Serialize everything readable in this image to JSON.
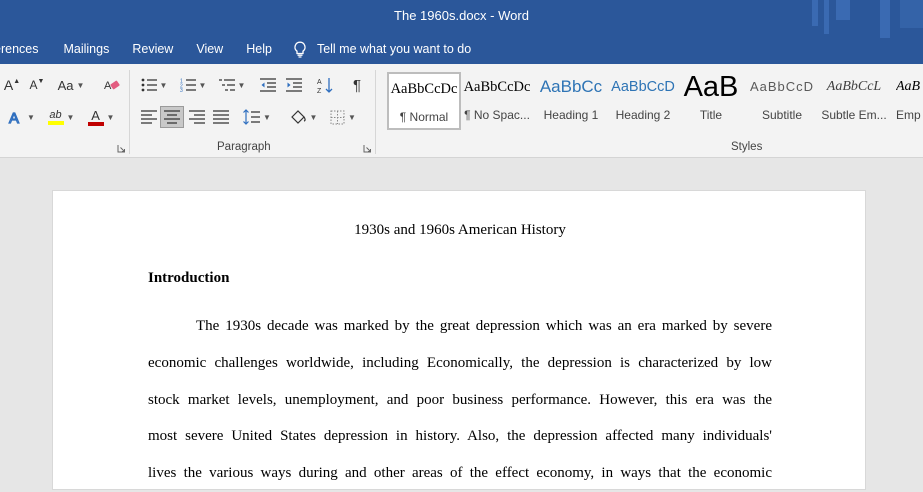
{
  "window": {
    "title": "The 1960s.docx  -  Word"
  },
  "ribbon_tabs": [
    "erences",
    "Mailings",
    "Review",
    "View",
    "Help"
  ],
  "tell_me": {
    "label": "Tell me what you want to do",
    "icon": "lightbulb-icon"
  },
  "font_group": {
    "grow_label": "A",
    "shrink_label": "A",
    "case_label": "Aa",
    "highlight_label": "ab",
    "font_color_label": "A",
    "highlight_color": "#ffff00",
    "font_color": "#c00000"
  },
  "paragraph_group": {
    "label": "Paragraph",
    "show_marks": "¶",
    "selected_alignment": "center"
  },
  "styles_group": {
    "label": "Styles",
    "items": [
      {
        "sample": "AaBbCcDc",
        "name": "¶ Normal",
        "selected": true
      },
      {
        "sample": "AaBbCcDc",
        "name": "¶ No Spac..."
      },
      {
        "sample": "AaBbCc",
        "name": "Heading 1"
      },
      {
        "sample": "AaBbCcD",
        "name": "Heading 2"
      },
      {
        "sample": "AaB",
        "name": "Title"
      },
      {
        "sample": "AaBbCcD",
        "name": "Subtitle"
      },
      {
        "sample": "AaBbCcL",
        "name": "Subtle Em..."
      },
      {
        "sample": "AaB",
        "name": "Emp"
      }
    ]
  },
  "document": {
    "title": "1930s and 1960s American History",
    "heading": "Introduction",
    "paragraph_lines": [
      "The 1930s decade was marked by the great depression which was an era marked by severe",
      "economic challenges worldwide, including Economically, the depression is characterized by low",
      "stock market levels, unemployment, and poor business performance. However, this era was the",
      "most severe United States depression in history. Also, the depression affected many individuals'",
      "lives the various ways during and other areas of the effect economy, in ways that the economic"
    ]
  },
  "colors": {
    "title_bar": "#2b579a",
    "ribbon": "#f3f3f3",
    "canvas": "#e6e6e6"
  }
}
